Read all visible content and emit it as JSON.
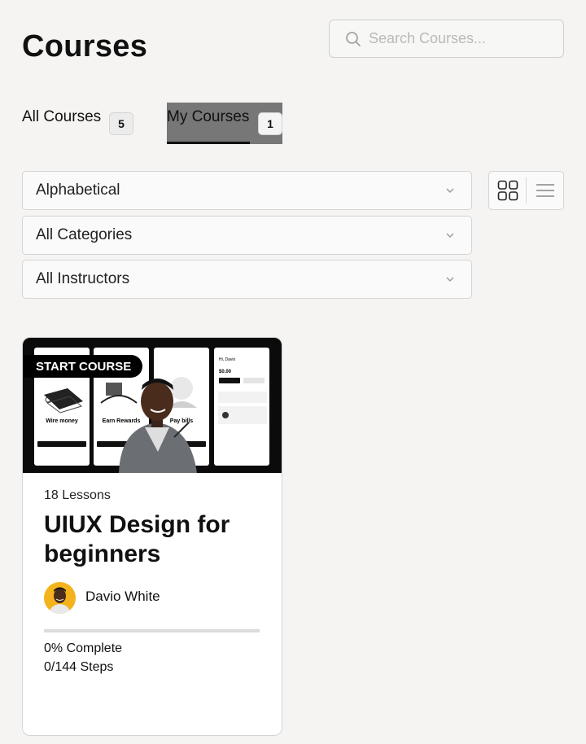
{
  "header": {
    "title": "Courses",
    "search_placeholder": "Search Courses..."
  },
  "tabs": [
    {
      "label": "All Courses",
      "count": "5",
      "active": false
    },
    {
      "label": "My Courses",
      "count": "1",
      "active": true
    }
  ],
  "filters": {
    "sort": "Alphabetical",
    "category": "All Categories",
    "instructor": "All Instructors"
  },
  "view_toggle": {
    "grid_icon": "grid-view-icon",
    "list_icon": "list-view-icon",
    "active": "grid"
  },
  "course": {
    "badge": "START COURSE",
    "lessons": "18 Lessons",
    "title": "UIUX Design for beginners",
    "instructor": "Davio White",
    "progress_percent": 0,
    "progress_label": "0% Complete",
    "steps": "0/144 Steps",
    "thumbnail_screens": [
      "Wire money",
      "Earn Rewards",
      "Pay bills"
    ],
    "balance_text": "$0.00",
    "greeting": "Hi, Davio"
  },
  "colors": {
    "background": "#f5f4f2",
    "active_tab_bg": "#777777",
    "avatar_bg": "#f4b31c"
  }
}
